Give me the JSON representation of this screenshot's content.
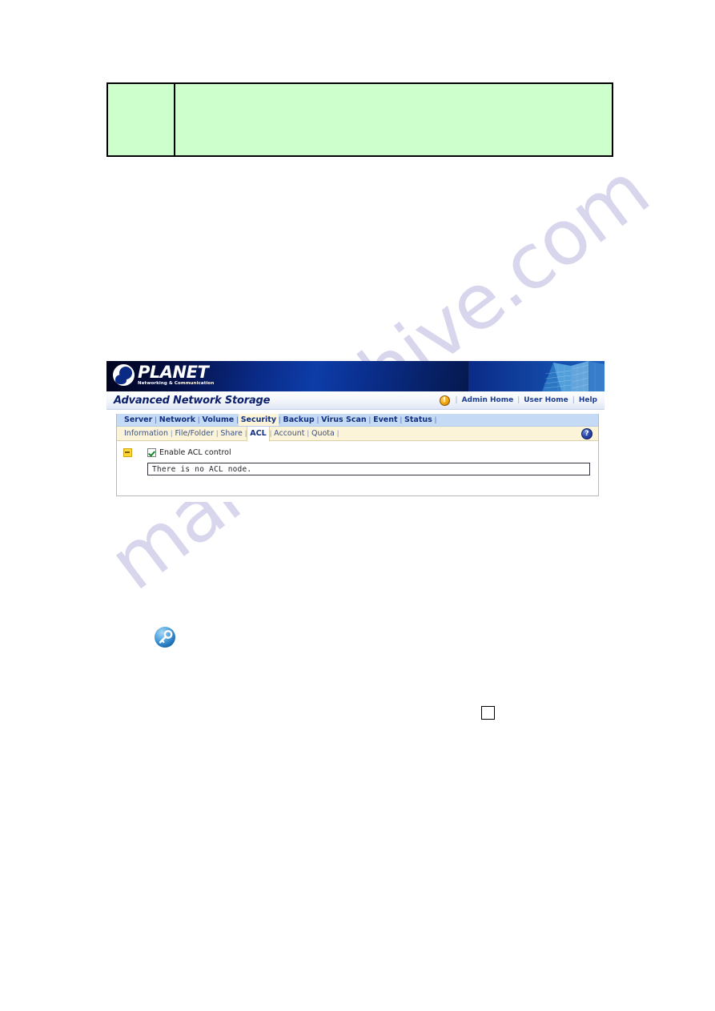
{
  "page": {
    "background_color": "#ffffff",
    "watermark_text": "manualshive.com",
    "watermark_color": "#b9b6e0"
  },
  "note_box": {
    "left_cell_text": "",
    "right_cell_text": "",
    "fill_color": "#ccffcc",
    "border_color": "#000000"
  },
  "screenshot": {
    "banner": {
      "logo_name": "PLANET",
      "logo_tagline": "Networking & Communication",
      "background_color": "#0a2a86"
    },
    "subheader": {
      "app_title": "Advanced Network Storage",
      "alert_icon": "alert-exclamation-icon",
      "links": [
        {
          "label": "Admin Home"
        },
        {
          "label": "User Home"
        },
        {
          "label": "Help"
        }
      ],
      "separator": "|"
    },
    "primary_tabs": {
      "active": "Security",
      "active_bg": "#fcf4d9",
      "bar_bg": "#c5daf5",
      "separator": "|",
      "items": [
        {
          "label": "Server"
        },
        {
          "label": "Network"
        },
        {
          "label": "Volume"
        },
        {
          "label": "Security"
        },
        {
          "label": "Backup"
        },
        {
          "label": "Virus Scan"
        },
        {
          "label": "Event"
        },
        {
          "label": "Status"
        }
      ]
    },
    "secondary_tabs": {
      "active": "ACL",
      "bar_bg": "#fcf4d9",
      "separator": "|",
      "help_icon": "help-question-icon",
      "items": [
        {
          "label": "Information"
        },
        {
          "label": "File/Folder"
        },
        {
          "label": "Share"
        },
        {
          "label": "ACL"
        },
        {
          "label": "Account"
        },
        {
          "label": "Quota"
        }
      ]
    },
    "content": {
      "bullet_icon": "yellow-arrow-bullet-icon",
      "enable_checkbox_checked": true,
      "enable_label": "Enable ACL control",
      "acl_node_message": "There is no ACL node."
    }
  },
  "figures": {
    "key_icon": "blue-key-icon",
    "empty_checkbox": "empty-checkbox-square"
  }
}
